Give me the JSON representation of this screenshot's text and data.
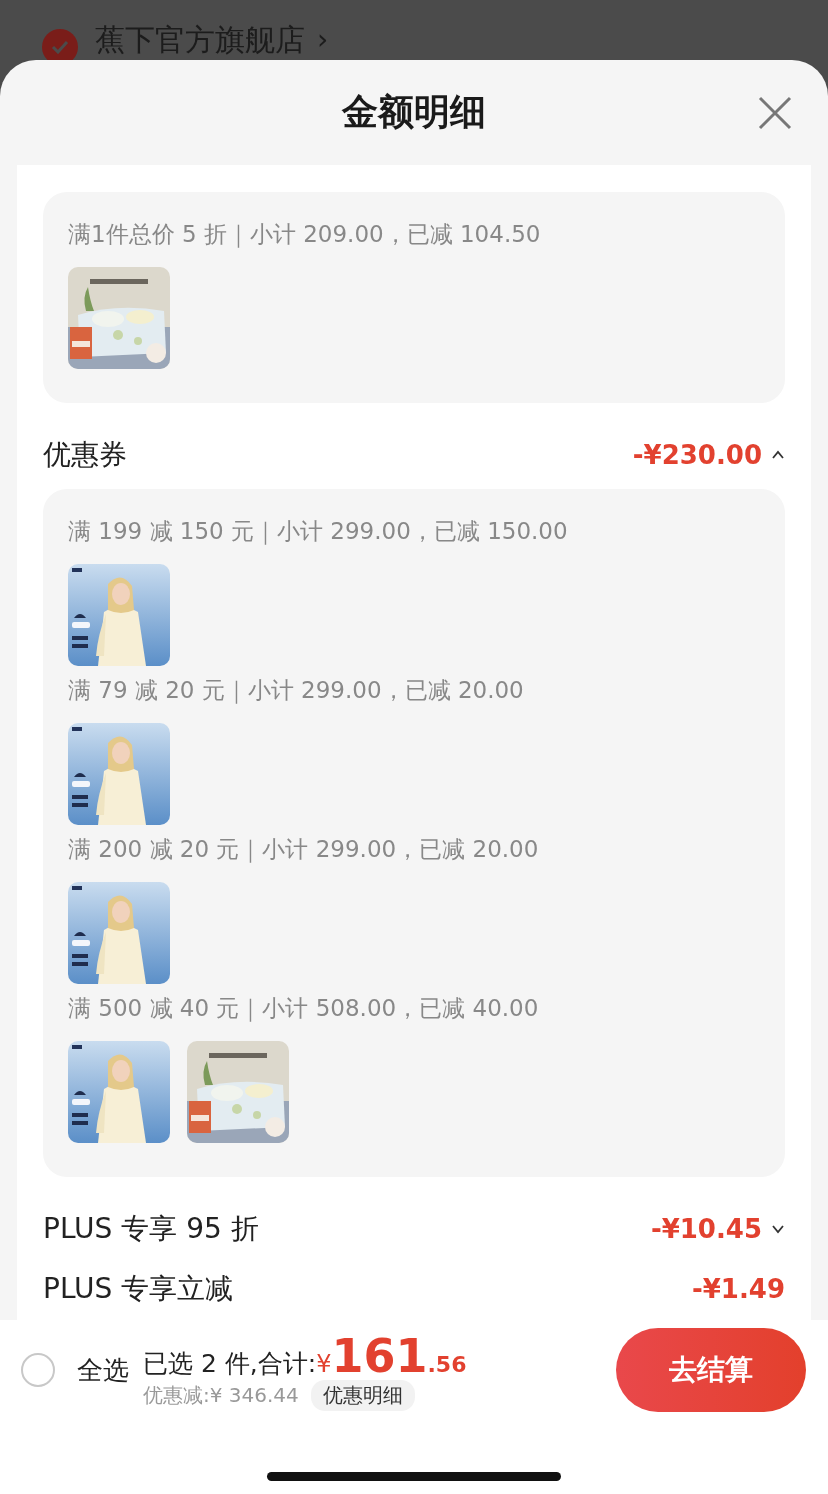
{
  "store": {
    "name": "蕉下官方旗舰店",
    "arrow": "›",
    "checked": true
  },
  "sheet": {
    "title": "金额明细"
  },
  "sections": [
    {
      "groups": [
        {
          "rule": "满1件总价 5 折｜小计 209.00，已减 104.50",
          "products": [
            {
              "kind": "bedding"
            }
          ]
        }
      ]
    },
    {
      "title": "优惠券",
      "amount": "-¥230.00",
      "expanded": true,
      "groups": [
        {
          "rule": "满 199 减 150 元｜小计 299.00，已减 150.00",
          "products": [
            {
              "kind": "apparel"
            }
          ]
        },
        {
          "rule": "满 79 减 20 元｜小计 299.00，已减 20.00",
          "products": [
            {
              "kind": "apparel"
            }
          ]
        },
        {
          "rule": "满 200 减 20 元｜小计 299.00，已减 20.00",
          "products": [
            {
              "kind": "apparel"
            }
          ]
        },
        {
          "rule": "满 500 减 40 元｜小计 508.00，已减 40.00",
          "products": [
            {
              "kind": "apparel"
            },
            {
              "kind": "bedding"
            }
          ]
        }
      ]
    },
    {
      "title": "PLUS 专享 95 折",
      "amount": "-¥10.45",
      "expanded": false
    },
    {
      "title": "PLUS 专享立减",
      "amount": "-¥1.49"
    }
  ],
  "checkout": {
    "select_all": {
      "label": "全选",
      "checked": false
    },
    "summary": "已选 2 件,合计:",
    "currency": "¥",
    "total_int": "161",
    "total_dec": ".56",
    "discount": "优惠减:¥ 346.44",
    "detail_button": "优惠明细",
    "submit": "去结算"
  }
}
